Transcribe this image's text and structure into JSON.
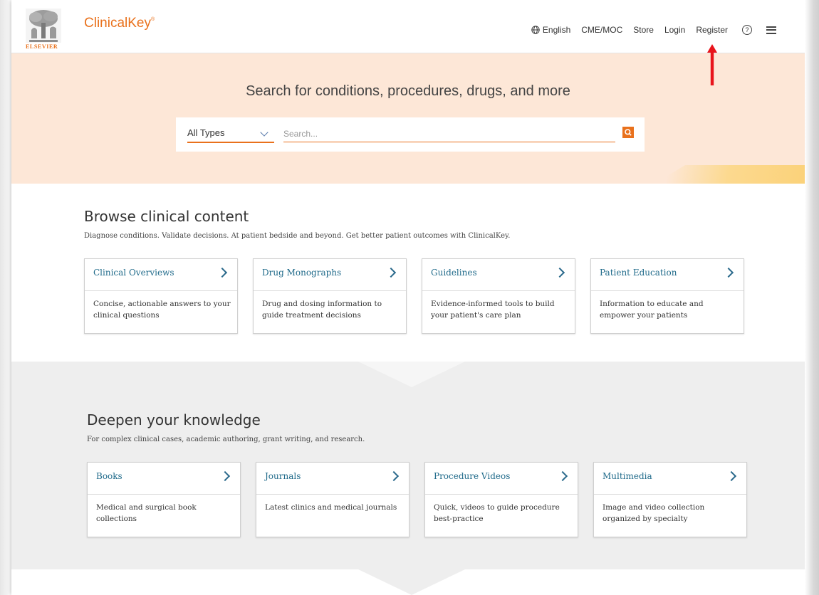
{
  "header": {
    "publisher": "ELSEVIER",
    "brand": "ClinicalKey",
    "brand_mark": "®",
    "nav": {
      "language": "English",
      "cme": "CME/MOC",
      "store": "Store",
      "login": "Login",
      "register": "Register"
    },
    "icons": [
      "globe-icon",
      "help-icon",
      "hamburger-menu-icon"
    ]
  },
  "hero": {
    "title": "Search for conditions, procedures, drugs, and more",
    "type_select": "All Types",
    "search_placeholder": "Search...",
    "search_icon": "search-icon"
  },
  "browse": {
    "title": "Browse clinical content",
    "subtitle": "Diagnose conditions. Validate decisions. At patient bedside and beyond. Get better patient outcomes with ClinicalKey.",
    "cards": [
      {
        "title": "Clinical Overviews",
        "desc": "Concise, actionable answers to your clinical questions"
      },
      {
        "title": "Drug Monographs",
        "desc": "Drug and dosing information to guide treatment decisions"
      },
      {
        "title": "Guidelines",
        "desc": "Evidence-informed tools to build your patient's care plan"
      },
      {
        "title": "Patient Education",
        "desc": "Information to educate and empower your patients"
      }
    ]
  },
  "deepen": {
    "title": "Deepen your knowledge",
    "subtitle": "For complex clinical cases, academic authoring, grant writing, and research.",
    "cards": [
      {
        "title": "Books",
        "desc": "Medical and surgical book collections"
      },
      {
        "title": "Journals",
        "desc": "Latest clinics and medical journals"
      },
      {
        "title": "Procedure Videos",
        "desc": "Quick, videos to guide procedure best-practice"
      },
      {
        "title": "Multimedia",
        "desc": "Image and video collection organized by specialty"
      }
    ]
  },
  "colors": {
    "accent": "#e9711c",
    "link": "#1f6a8a",
    "hero_bg": "#fde7d7",
    "band_bg": "#eeeeee",
    "annotation": "#e8141b"
  }
}
